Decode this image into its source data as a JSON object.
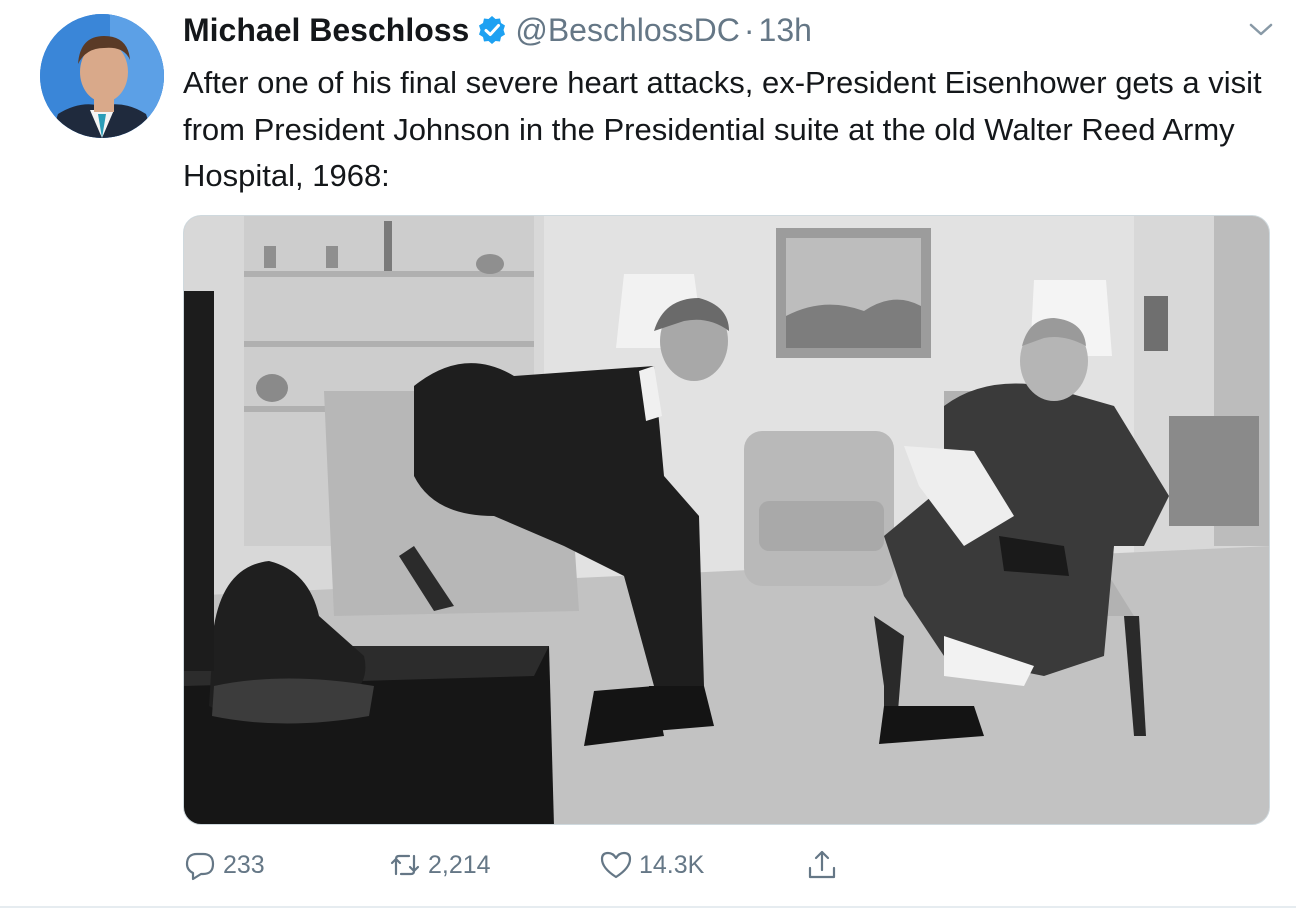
{
  "tweet": {
    "author_name": "Michael Beschloss",
    "handle": "@BeschlossDC",
    "separator": "·",
    "time": "13h",
    "text": "After one of his final severe heart attacks, ex-President Eisenhower gets a visit from President Johnson in the Presidential suite at the old Walter Reed Army Hospital, 1968:",
    "verified": true,
    "media": {
      "icon": "photo-eisenhower-johnson-1968"
    },
    "actions": {
      "reply_count": "233",
      "retweet_count": "2,214",
      "like_count": "14.3K"
    }
  },
  "colors": {
    "verified_blue": "#1da1f2",
    "secondary_text": "#657786",
    "primary_text": "#14171a"
  }
}
